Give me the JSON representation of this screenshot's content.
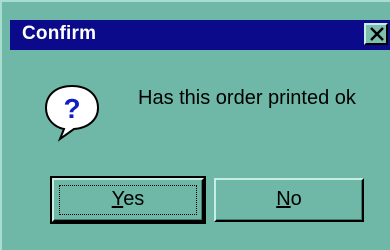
{
  "window": {
    "title": "Confirm",
    "close_glyph": "X"
  },
  "dialog": {
    "icon": "question-icon",
    "icon_glyph": "?",
    "message": "Has this order printed ok"
  },
  "buttons": {
    "yes": {
      "mnemonic": "Y",
      "rest": "es"
    },
    "no": {
      "mnemonic": "N",
      "rest": "o"
    }
  },
  "colors": {
    "titlebar": "#0a0a8a",
    "dialog_bg": "#6fb8a8",
    "icon_blue": "#1020c0"
  }
}
